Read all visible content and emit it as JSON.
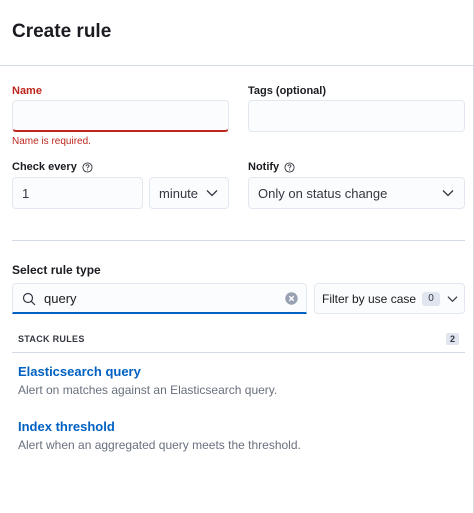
{
  "flyout": {
    "title": "Create rule"
  },
  "form": {
    "name": {
      "label": "Name",
      "value": "",
      "error": "Name is required."
    },
    "tags": {
      "label": "Tags (optional)",
      "value": ""
    },
    "check_every": {
      "label": "Check every",
      "value": "1",
      "unit": "minute"
    },
    "notify": {
      "label": "Notify",
      "value": "Only on status change"
    }
  },
  "rule_type": {
    "section_title": "Select rule type",
    "search_value": "query",
    "filter_label": "Filter by use case",
    "filter_count": "0",
    "group": {
      "name": "STACK RULES",
      "count": "2",
      "items": [
        {
          "title": "Elasticsearch query",
          "description": "Alert on matches against an Elasticsearch query."
        },
        {
          "title": "Index threshold",
          "description": "Alert when an aggregated query meets the threshold."
        }
      ]
    }
  },
  "colors": {
    "error": "#bd271e",
    "link": "#0061c2",
    "border": "#d3dae6"
  },
  "icons": {
    "help": "question-circle-icon",
    "chevron": "chevron-down-icon",
    "search": "search-icon",
    "clear": "clear-icon"
  }
}
